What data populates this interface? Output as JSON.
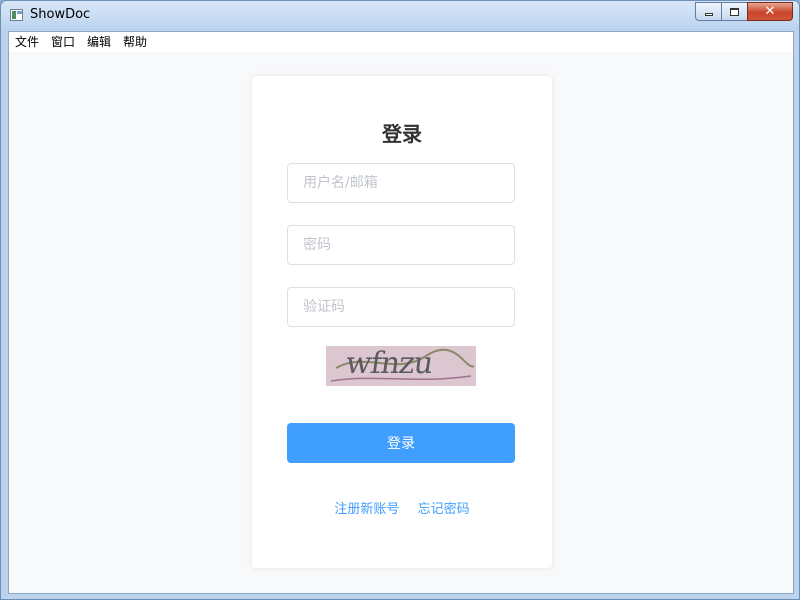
{
  "window": {
    "title": "ShowDoc",
    "close_glyph": "✕"
  },
  "menu": {
    "items": [
      "文件",
      "窗口",
      "编辑",
      "帮助"
    ]
  },
  "login": {
    "title": "登录",
    "username_placeholder": "用户名/邮箱",
    "password_placeholder": "密码",
    "captcha_placeholder": "验证码",
    "captcha_image_text": "wfnzu",
    "submit_label": "登录",
    "register_link": "注册新账号",
    "forgot_link": "忘记密码"
  },
  "colors": {
    "primary": "#409eff",
    "card_bg": "#ffffff",
    "page_bg": "#f8f9fa"
  },
  "icons": [
    "app-icon",
    "minimize-icon",
    "maximize-icon",
    "close-icon"
  ]
}
